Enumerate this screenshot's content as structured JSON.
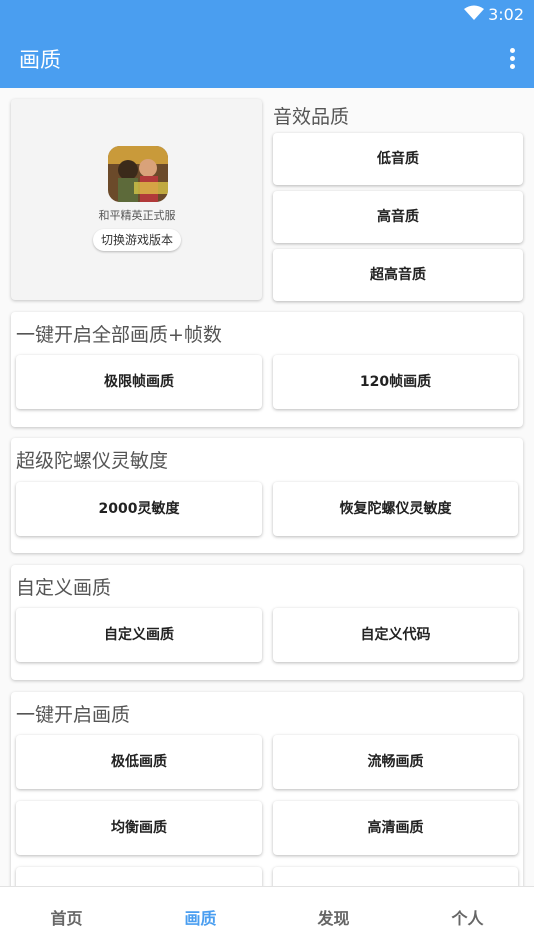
{
  "status_bar": {
    "time": "3:02"
  },
  "app_bar": {
    "title": "画质"
  },
  "game_card": {
    "name": "和平精英正式服",
    "switch_label": "切换游戏版本"
  },
  "sound_quality": {
    "title": "音效品质",
    "buttons": [
      "低音质",
      "高音质",
      "超高音质"
    ]
  },
  "all_quality": {
    "title": "一键开启全部画质+帧数",
    "buttons": [
      "极限帧画质",
      "120帧画质"
    ]
  },
  "gyro": {
    "title": "超级陀螺仪灵敏度",
    "buttons": [
      "2000灵敏度",
      "恢复陀螺仪灵敏度"
    ]
  },
  "custom": {
    "title": "自定义画质",
    "buttons": [
      "自定义画质",
      "自定义代码"
    ]
  },
  "one_key": {
    "title": "一键开启画质",
    "buttons": [
      "极低画质",
      "流畅画质",
      "均衡画质",
      "高清画质"
    ]
  },
  "bottom_nav": {
    "items": [
      "首页",
      "画质",
      "发现",
      "个人"
    ],
    "active": "画质"
  },
  "colors": {
    "primary": "#4a9ef0",
    "background": "#fafafa"
  }
}
